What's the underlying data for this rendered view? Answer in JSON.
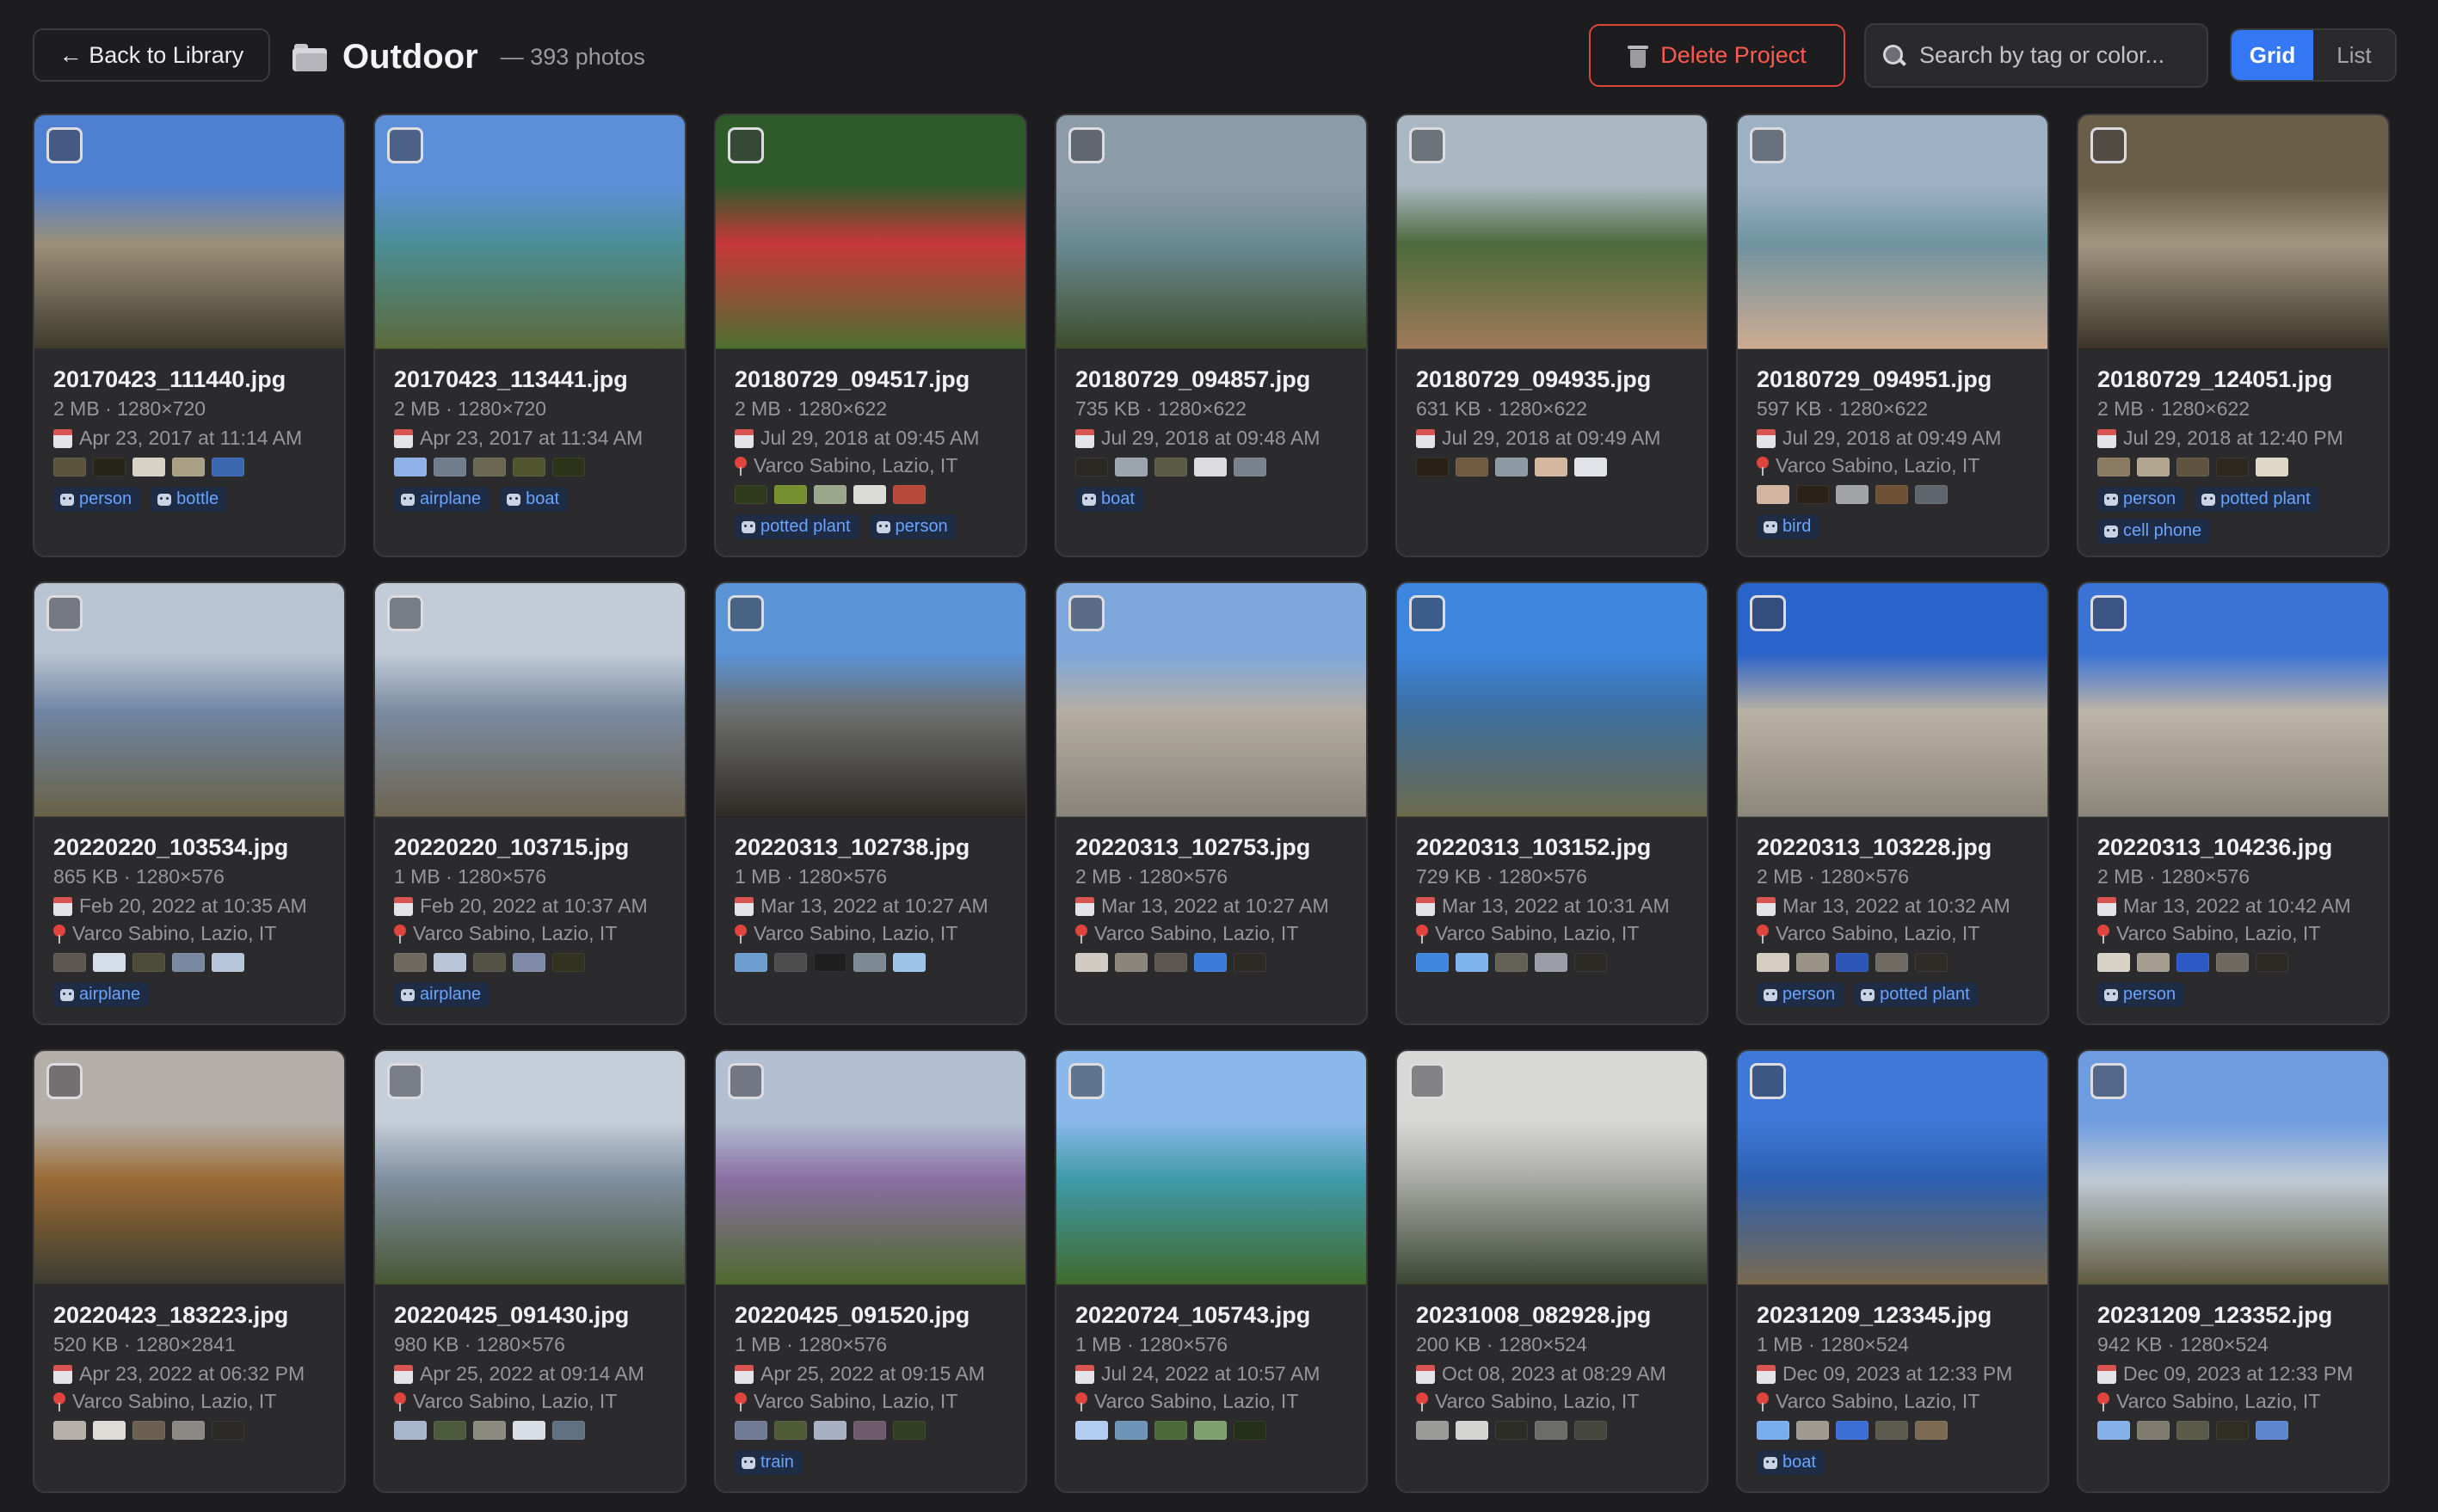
{
  "header": {
    "back_label": "← Back to Library",
    "folder_icon": "folder-icon",
    "title": "Outdoor",
    "count": "— 393 photos",
    "delete_label": "Delete Project",
    "search_placeholder": "Search by tag or color...",
    "view_grid": "Grid",
    "view_list": "List",
    "accent": "#3478f6",
    "danger": "#e0453d"
  },
  "photos": [
    {
      "file": "20170423_111440.jpg",
      "meta": "2 MB · 1280×720",
      "date": "Apr 23, 2017 at 11:14 AM",
      "location": "",
      "colors": [
        "#5b543d",
        "#262519",
        "#d7d2c3",
        "#a89f85",
        "#3b66b0"
      ],
      "tags": [
        "person",
        "bottle"
      ],
      "scene": [
        "#4f7fd0",
        "#9b8f78",
        "#3f3a2c"
      ]
    },
    {
      "file": "20170423_113441.jpg",
      "meta": "2 MB · 1280×720",
      "date": "Apr 23, 2017 at 11:34 AM",
      "location": "",
      "colors": [
        "#8fb0e8",
        "#6f7d8c",
        "#6a6650",
        "#50542f",
        "#2d3319"
      ],
      "tags": [
        "airplane",
        "boat"
      ],
      "scene": [
        "#5d8fd8",
        "#4c8e95",
        "#5b6a3a"
      ]
    },
    {
      "file": "20180729_094517.jpg",
      "meta": "2 MB · 1280×622",
      "date": "Jul 29, 2018 at 09:45 AM",
      "location": "Varco Sabino, Lazio, IT",
      "colors": [
        "#2f3a1c",
        "#76902f",
        "#9aa78a",
        "#dcdcd6",
        "#b8483a"
      ],
      "tags": [
        "potted plant",
        "person"
      ],
      "scene": [
        "#2f5a2a",
        "#c8383a",
        "#4c6f2f"
      ]
    },
    {
      "file": "20180729_094857.jpg",
      "meta": "735 KB · 1280×622",
      "date": "Jul 29, 2018 at 09:48 AM",
      "location": "",
      "colors": [
        "#2a2923",
        "#9aa5ae",
        "#5b5b45",
        "#dcdcdf",
        "#77828d"
      ],
      "tags": [
        "boat"
      ],
      "scene": [
        "#8c9ba8",
        "#6a8a93",
        "#3c4d2a"
      ]
    },
    {
      "file": "20180729_094935.jpg",
      "meta": "631 KB · 1280×622",
      "date": "Jul 29, 2018 at 09:49 AM",
      "location": "",
      "colors": [
        "#2a2018",
        "#705a40",
        "#8e9aa3",
        "#d3b79e",
        "#e1e3e8"
      ],
      "tags": [],
      "scene": [
        "#a9b7c2",
        "#4b6a3b",
        "#a07a5a"
      ]
    },
    {
      "file": "20180729_094951.jpg",
      "meta": "597 KB · 1280×622",
      "date": "Jul 29, 2018 at 09:49 AM",
      "location": "Varco Sabino, Lazio, IT",
      "colors": [
        "#d2b4a0",
        "#2c2119",
        "#a1a3a6",
        "#6d5134",
        "#5f656d"
      ],
      "tags": [
        "bird"
      ],
      "scene": [
        "#9db1c4",
        "#6f93a0",
        "#cfab91"
      ]
    },
    {
      "file": "20180729_124051.jpg",
      "meta": "2 MB · 1280×622",
      "date": "Jul 29, 2018 at 12:40 PM",
      "location": "",
      "colors": [
        "#8b7b62",
        "#b2a590",
        "#5e5440",
        "#2e2820",
        "#dfd8c8"
      ],
      "tags": [
        "person",
        "potted plant",
        "cell phone"
      ],
      "scene": [
        "#6b5e48",
        "#a19680",
        "#3b3327"
      ]
    },
    {
      "file": "20220220_103534.jpg",
      "meta": "865 KB · 1280×576",
      "date": "Feb 20, 2022 at 10:35 AM",
      "location": "Varco Sabino, Lazio, IT",
      "colors": [
        "#5c5750",
        "#d5dde8",
        "#4b4b37",
        "#7989a2",
        "#b8c6dc"
      ],
      "tags": [
        "airplane"
      ],
      "scene": [
        "#b9c4d2",
        "#6e86a3",
        "#6a6146"
      ]
    },
    {
      "file": "20220220_103715.jpg",
      "meta": "1 MB · 1280×576",
      "date": "Feb 20, 2022 at 10:37 AM",
      "location": "Varco Sabino, Lazio, IT",
      "colors": [
        "#6f6a60",
        "#b9c5d8",
        "#535244",
        "#7e8aa6",
        "#31311f"
      ],
      "tags": [
        "airplane"
      ],
      "scene": [
        "#c2ccd8",
        "#7a8aa0",
        "#6d6450"
      ]
    },
    {
      "file": "20220313_102738.jpg",
      "meta": "1 MB · 1280×576",
      "date": "Mar 13, 2022 at 10:27 AM",
      "location": "Varco Sabino, Lazio, IT",
      "colors": [
        "#6d9ed0",
        "#4d4d4d",
        "#1f1f1f",
        "#7d8a94",
        "#9cc4e8"
      ],
      "tags": [],
      "scene": [
        "#5a93d6",
        "#6d6f6e",
        "#2e2a26"
      ]
    },
    {
      "file": "20220313_102753.jpg",
      "meta": "2 MB · 1280×576",
      "date": "Mar 13, 2022 at 10:27 AM",
      "location": "Varco Sabino, Lazio, IT",
      "colors": [
        "#d1cbc3",
        "#8b857b",
        "#5b5650",
        "#3b7ad8",
        "#2e2a25"
      ],
      "tags": [],
      "scene": [
        "#7ea8dc",
        "#b5ada2",
        "#8a8379"
      ]
    },
    {
      "file": "20220313_103152.jpg",
      "meta": "729 KB · 1280×576",
      "date": "Mar 13, 2022 at 10:31 AM",
      "location": "Varco Sabino, Lazio, IT",
      "colors": [
        "#3f86de",
        "#7db4ee",
        "#636055",
        "#9a9ca6",
        "#2c2b26"
      ],
      "tags": [],
      "scene": [
        "#3d86e0",
        "#3d6e9e",
        "#6b6a4b"
      ]
    },
    {
      "file": "20220313_103228.jpg",
      "meta": "2 MB · 1280×576",
      "date": "Mar 13, 2022 at 10:32 AM",
      "location": "Varco Sabino, Lazio, IT",
      "colors": [
        "#d5cdbf",
        "#9a9385",
        "#2c55b8",
        "#6f6a62",
        "#2f2b27"
      ],
      "tags": [
        "person",
        "potted plant"
      ],
      "scene": [
        "#2a63c9",
        "#b9b1a4",
        "#8d867a"
      ]
    },
    {
      "file": "20220313_104236.jpg",
      "meta": "2 MB · 1280×576",
      "date": "Mar 13, 2022 at 10:42 AM",
      "location": "Varco Sabino, Lazio, IT",
      "colors": [
        "#d8d2c6",
        "#a39c8f",
        "#2c5ac4",
        "#6f6a61",
        "#2d2a26"
      ],
      "tags": [
        "person"
      ],
      "scene": [
        "#3a72d6",
        "#bdb5a8",
        "#8b8478"
      ]
    },
    {
      "file": "20220423_183223.jpg",
      "meta": "520 KB · 1280×2841",
      "date": "Apr 23, 2022 at 06:32 PM",
      "location": "Varco Sabino, Lazio, IT",
      "colors": [
        "#b5b1aa",
        "#dedcd7",
        "#6b5f52",
        "#8c8984",
        "#2c2a27"
      ],
      "tags": [],
      "scene": [
        "#b4b0a9",
        "#9b6a35",
        "#3a3c30"
      ]
    },
    {
      "file": "20220425_091430.jpg",
      "meta": "980 KB · 1280×576",
      "date": "Apr 25, 2022 at 09:14 AM",
      "location": "Varco Sabino, Lazio, IT",
      "colors": [
        "#a8b6cd",
        "#4b5a3b",
        "#8b8a7e",
        "#d9dde6",
        "#607184"
      ],
      "tags": [],
      "scene": [
        "#c6ced9",
        "#7f8e9f",
        "#475632"
      ]
    },
    {
      "file": "20220425_091520.jpg",
      "meta": "1 MB · 1280×576",
      "date": "Apr 25, 2022 at 09:15 AM",
      "location": "Varco Sabino, Lazio, IT",
      "colors": [
        "#6f7a94",
        "#4f5a37",
        "#a8b0c3",
        "#6f5a6b",
        "#333d22"
      ],
      "tags": [
        "train"
      ],
      "scene": [
        "#b3bfd2",
        "#8a6fa3",
        "#4e6a2c"
      ]
    },
    {
      "file": "20220724_105743.jpg",
      "meta": "1 MB · 1280×576",
      "date": "Jul 24, 2022 at 10:57 AM",
      "location": "Varco Sabino, Lazio, IT",
      "colors": [
        "#b2cdf0",
        "#6e95b8",
        "#4d6a3a",
        "#7ea070",
        "#24301a"
      ],
      "tags": [],
      "scene": [
        "#8ab8ea",
        "#3f9aa8",
        "#3f6a2c"
      ]
    },
    {
      "file": "20231008_082928.jpg",
      "meta": "200 KB · 1280×524",
      "date": "Oct 08, 2023 at 08:29 AM",
      "location": "Varco Sabino, Lazio, IT",
      "colors": [
        "#9a9a98",
        "#d4d4d2",
        "#2c2e26",
        "#6c6d68",
        "#45473f"
      ],
      "tags": [],
      "scene": [
        "#d8d8d6",
        "#a9aaa6",
        "#3a4532"
      ]
    },
    {
      "file": "20231209_123345.jpg",
      "meta": "1 MB · 1280×524",
      "date": "Dec 09, 2023 at 12:33 PM",
      "location": "Varco Sabino, Lazio, IT",
      "colors": [
        "#78aef0",
        "#a09a90",
        "#3c6ed6",
        "#5c5a4c",
        "#7c6a52"
      ],
      "tags": [
        "boat"
      ],
      "scene": [
        "#3f78d8",
        "#2c5fb0",
        "#7a6a4e"
      ]
    },
    {
      "file": "20231209_123352.jpg",
      "meta": "942 KB · 1280×524",
      "date": "Dec 09, 2023 at 12:33 PM",
      "location": "Varco Sabino, Lazio, IT",
      "colors": [
        "#86b0ea",
        "#7e7a6e",
        "#5a5a48",
        "#2e2e24",
        "#5c86d0"
      ],
      "tags": [],
      "scene": [
        "#6f9ce0",
        "#c0cad6",
        "#5e5a3e"
      ]
    }
  ]
}
